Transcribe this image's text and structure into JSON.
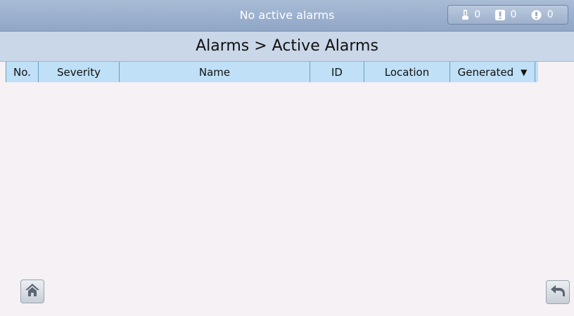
{
  "topbar": {
    "title": "No active alarms"
  },
  "alarm_counter": {
    "minor": {
      "icon": "minor-alarm-icon",
      "count": "0"
    },
    "major": {
      "icon": "major-alarm-icon",
      "count": "0"
    },
    "critical": {
      "icon": "critical-alarm-icon",
      "count": "0"
    }
  },
  "breadcrumb": {
    "text": "Alarms > Active Alarms"
  },
  "table": {
    "columns": [
      "No.",
      "Severity",
      "Name",
      "ID",
      "Location",
      "Generated"
    ],
    "sort_icon": "sort-down-icon",
    "rows": []
  },
  "buttons": {
    "home_icon": "home-icon",
    "back_icon": "back-arrow-icon"
  },
  "colors": {
    "topbar": "#98accb",
    "breadcrumb_bar": "#c9d7e8",
    "table_header": "#bfe0f6",
    "background": "#f5f1f5"
  }
}
